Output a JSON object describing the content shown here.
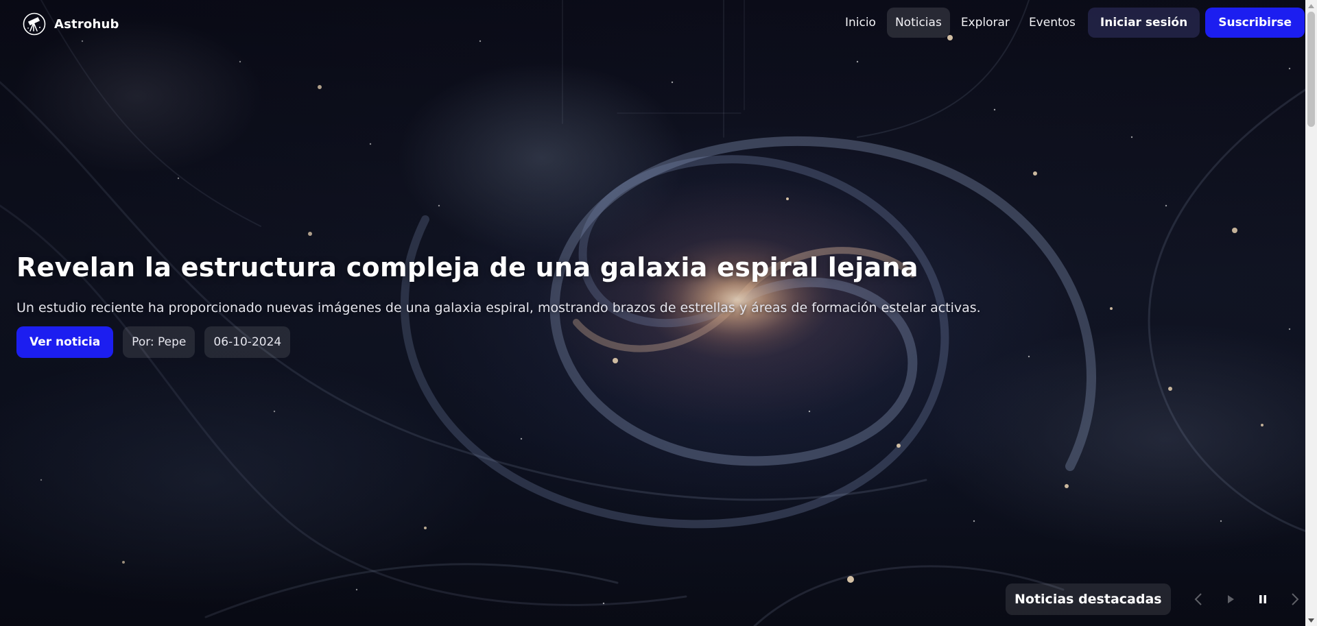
{
  "brand": {
    "name": "Astrohub",
    "logo_icon": "telescope-icon"
  },
  "nav": {
    "links": [
      {
        "label": "Inicio",
        "active": false
      },
      {
        "label": "Noticias",
        "active": true
      },
      {
        "label": "Explorar",
        "active": false
      },
      {
        "label": "Eventos",
        "active": false
      }
    ],
    "login_label": "Iniciar sesión",
    "subscribe_label": "Suscribirse"
  },
  "hero": {
    "title": "Revelan la estructura compleja de una galaxia espiral lejana",
    "subtitle": "Un estudio reciente ha proporcionado nuevas imágenes de una galaxia espiral, mostrando brazos de estrellas y áreas de formación estelar activas.",
    "cta_label": "Ver noticia",
    "author": "Por: Pepe",
    "date": "06-10-2024",
    "background": "spiral-galaxy-image"
  },
  "featured": {
    "label": "Noticias destacadas",
    "controls": [
      "chevron-left-icon",
      "play-icon",
      "pause-icon",
      "chevron-right-icon"
    ]
  },
  "colors": {
    "accent": "#1c1ef0",
    "login_bg": "#28285a"
  }
}
